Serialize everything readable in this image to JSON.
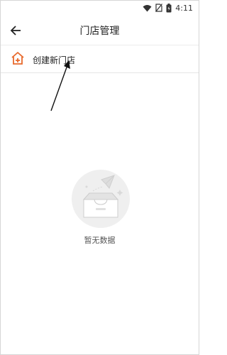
{
  "status_bar": {
    "time": "4:11",
    "icons": [
      "wifi-icon",
      "no-sim-icon",
      "battery-icon"
    ]
  },
  "app_bar": {
    "back_icon": "back-arrow-icon",
    "title": "门店管理"
  },
  "create_store": {
    "icon": "house-plus-icon",
    "label": "创建新门店"
  },
  "empty_state": {
    "icon": "empty-box-paper-plane-icon",
    "text": "暂无数据"
  },
  "colors": {
    "accent": "#e8692c",
    "annotation": "#111111"
  }
}
